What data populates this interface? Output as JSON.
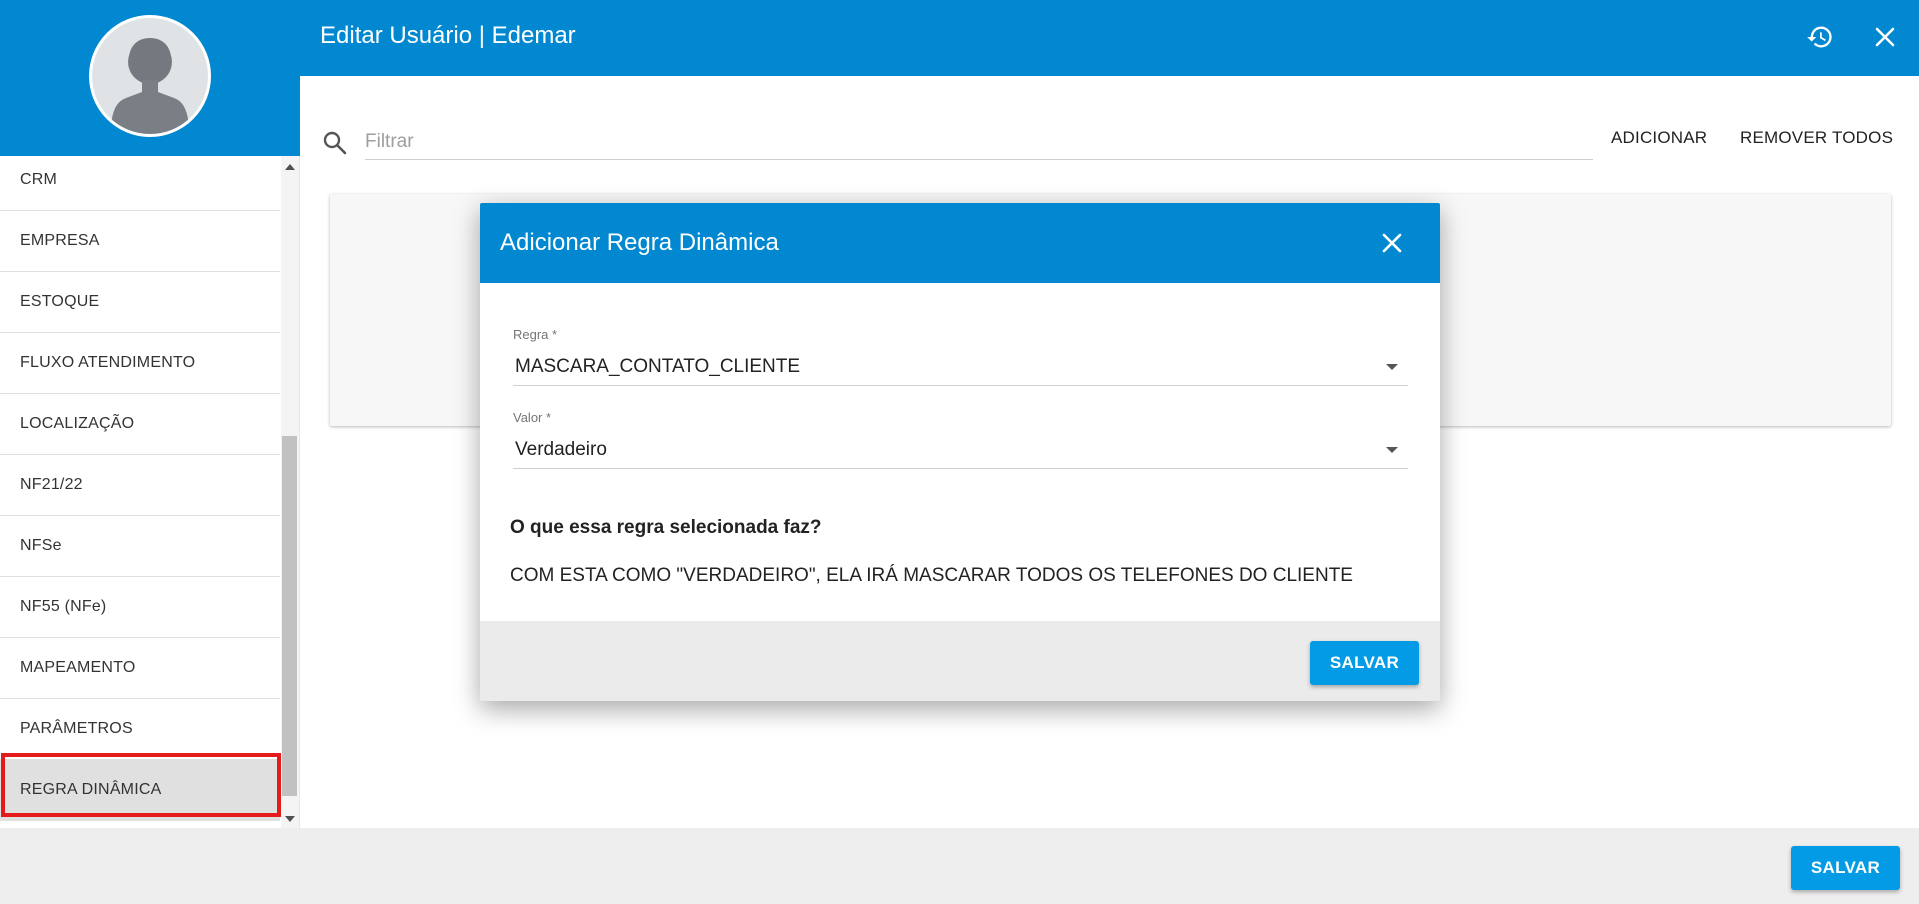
{
  "topbar": {
    "title": "Editar Usuário | Edemar",
    "history_icon": "history-icon",
    "close_icon": "close-icon"
  },
  "sidebar": {
    "avatar_icon": "user-avatar-icon",
    "items": [
      {
        "label": "CRM"
      },
      {
        "label": "EMPRESA"
      },
      {
        "label": "ESTOQUE"
      },
      {
        "label": "FLUXO ATENDIMENTO"
      },
      {
        "label": "LOCALIZAÇÃO"
      },
      {
        "label": "NF21/22"
      },
      {
        "label": "NFSe"
      },
      {
        "label": "NF55 (NFe)"
      },
      {
        "label": "MAPEAMENTO"
      },
      {
        "label": "PARÂMETROS"
      },
      {
        "label": "REGRA DINÂMICA",
        "active": true
      }
    ]
  },
  "filter": {
    "placeholder": "Filtrar",
    "value": "",
    "add_label": "ADICIONAR",
    "remove_all_label": "REMOVER TODOS"
  },
  "modal": {
    "title": "Adicionar Regra Dinâmica",
    "rule_label": "Regra *",
    "rule_value": "MASCARA_CONTATO_CLIENTE",
    "value_label": "Valor *",
    "value_value": "Verdadeiro",
    "question": "O que essa regra selecionada faz?",
    "answer": "COM ESTA COMO \"VERDADEIRO\", ELA IRÁ MASCARAR TODOS OS TELEFONES DO CLIENTE",
    "save_label": "SALVAR"
  },
  "footer": {
    "save_label": "SALVAR"
  },
  "colors": {
    "primary": "#0288d1",
    "button": "#039be5",
    "highlight": "#e31b1b"
  }
}
